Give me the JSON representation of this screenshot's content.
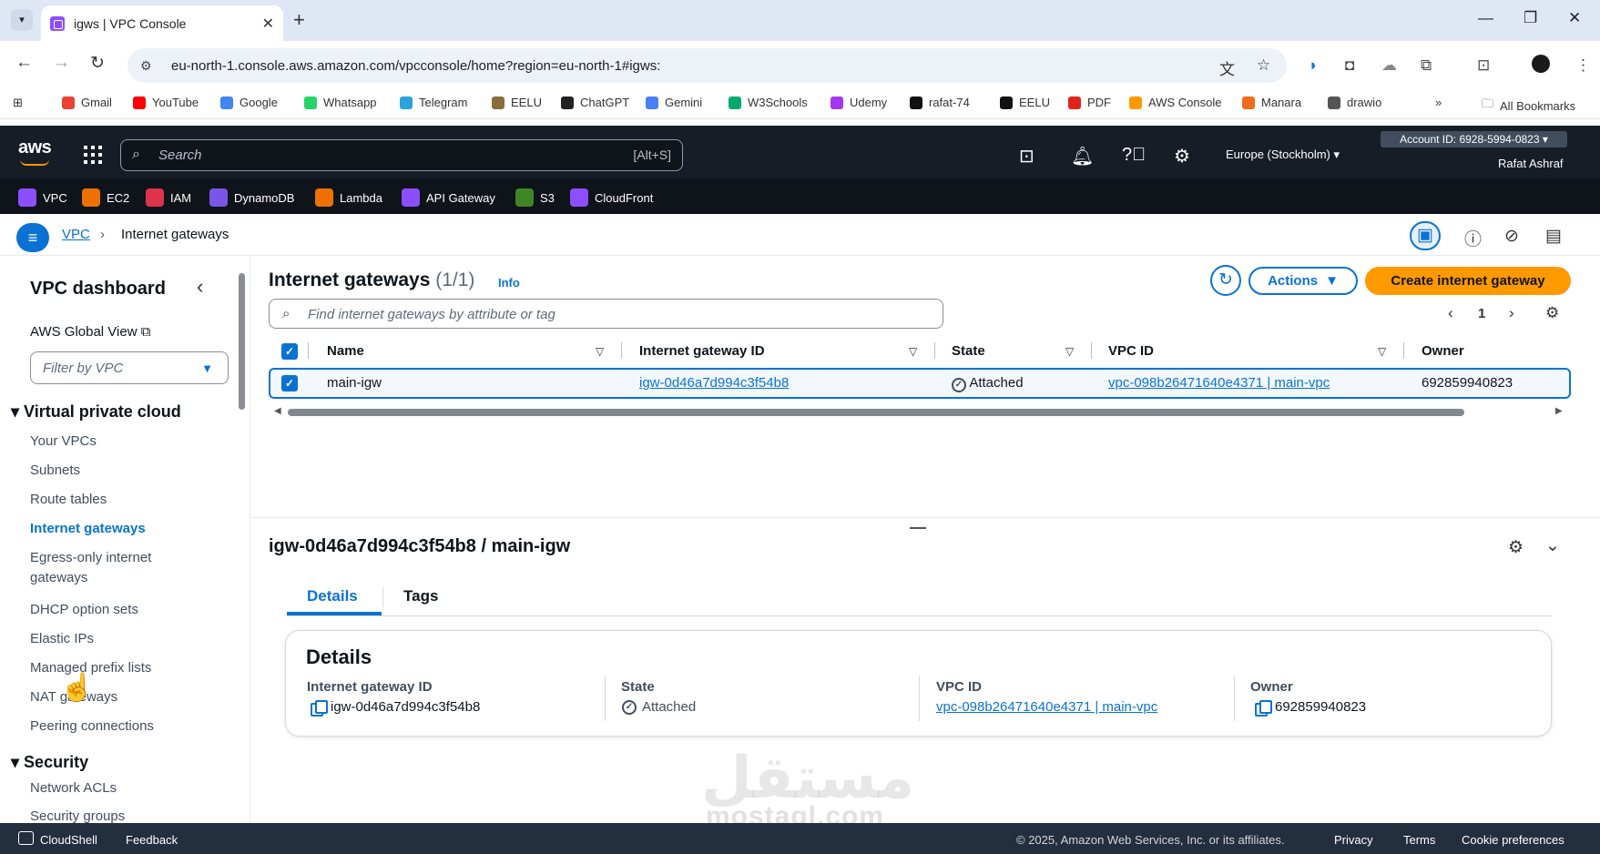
{
  "browser": {
    "tab_title": "igws | VPC Console",
    "url": "eu-north-1.console.aws.amazon.com/vpcconsole/home?region=eu-north-1#igws:",
    "bookmarks": [
      {
        "label": "Gmail",
        "color": "#ea4335"
      },
      {
        "label": "YouTube",
        "color": "#ff0000"
      },
      {
        "label": "Google",
        "color": "#4285f4"
      },
      {
        "label": "Whatsapp",
        "color": "#25d366"
      },
      {
        "label": "Telegram",
        "color": "#2aa3e0"
      },
      {
        "label": "EELU",
        "color": "#8a6d3b"
      },
      {
        "label": "ChatGPT",
        "color": "#222222"
      },
      {
        "label": "Gemini",
        "color": "#4a7ff5"
      },
      {
        "label": "W3Schools",
        "color": "#04aa6d"
      },
      {
        "label": "Udemy",
        "color": "#a435f0"
      },
      {
        "label": "rafat-74",
        "color": "#111111"
      },
      {
        "label": "EELU",
        "color": "#111111"
      },
      {
        "label": "PDF",
        "color": "#e2231a"
      },
      {
        "label": "AWS Console",
        "color": "#ff9900"
      },
      {
        "label": "Manara",
        "color": "#f26b1d"
      },
      {
        "label": "drawio",
        "color": "#555555"
      }
    ],
    "all_bookmarks": "All Bookmarks"
  },
  "aws_header": {
    "logo": "aws",
    "search_placeholder": "Search",
    "search_shortcut": "[Alt+S]",
    "region": "Europe (Stockholm)",
    "account": "Account ID: 6928-5994-0823",
    "user": "Rafat Ashraf",
    "services": [
      {
        "label": "VPC",
        "color": "#8c4fff"
      },
      {
        "label": "EC2",
        "color": "#ed7100"
      },
      {
        "label": "IAM",
        "color": "#dd344c"
      },
      {
        "label": "DynamoDB",
        "color": "#7b55e8"
      },
      {
        "label": "Lambda",
        "color": "#ed7100"
      },
      {
        "label": "API Gateway",
        "color": "#8c4fff"
      },
      {
        "label": "S3",
        "color": "#3f8624"
      },
      {
        "label": "CloudFront",
        "color": "#8c4fff"
      }
    ]
  },
  "breadcrumb": {
    "root": "VPC",
    "current": "Internet gateways"
  },
  "sidebar": {
    "title": "VPC dashboard",
    "global_view": "AWS Global View",
    "filter_placeholder": "Filter by VPC",
    "section_vpc": "Virtual private cloud",
    "items": [
      "Your VPCs",
      "Subnets",
      "Route tables",
      "Internet gateways",
      "Egress-only internet gateways",
      "DHCP option sets",
      "Elastic IPs",
      "Managed prefix lists",
      "NAT gateways",
      "Peering connections"
    ],
    "active_item": "Internet gateways",
    "section_security": "Security",
    "security_items": [
      "Network ACLs",
      "Security groups"
    ]
  },
  "main": {
    "title": "Internet gateways",
    "count": "(1/1)",
    "info": "Info",
    "actions": "Actions",
    "create": "Create internet gateway",
    "search_placeholder": "Find internet gateways by attribute or tag",
    "page": "1",
    "columns": [
      "Name",
      "Internet gateway ID",
      "State",
      "VPC ID",
      "Owner"
    ],
    "rows": [
      {
        "name": "main-igw",
        "id": "igw-0d46a7d994c3f54b8",
        "state": "Attached",
        "vpc": "vpc-098b26471640e4371 | main-vpc",
        "owner": "692859940823"
      }
    ]
  },
  "detail": {
    "title": "igw-0d46a7d994c3f54b8 / main-igw",
    "tabs": [
      "Details",
      "Tags"
    ],
    "card_title": "Details",
    "fields": [
      {
        "label": "Internet gateway ID",
        "value": "igw-0d46a7d994c3f54b8"
      },
      {
        "label": "State",
        "value": "Attached"
      },
      {
        "label": "VPC ID",
        "value": "vpc-098b26471640e4371 | main-vpc"
      },
      {
        "label": "Owner",
        "value": "692859940823"
      }
    ]
  },
  "watermark": {
    "arabic": "مستقل",
    "latin": "mostaql.com"
  },
  "footer": {
    "cloudshell": "CloudShell",
    "feedback": "Feedback",
    "copyright": "© 2025, Amazon Web Services, Inc. or its affiliates.",
    "privacy": "Privacy",
    "terms": "Terms",
    "cookies": "Cookie preferences"
  }
}
